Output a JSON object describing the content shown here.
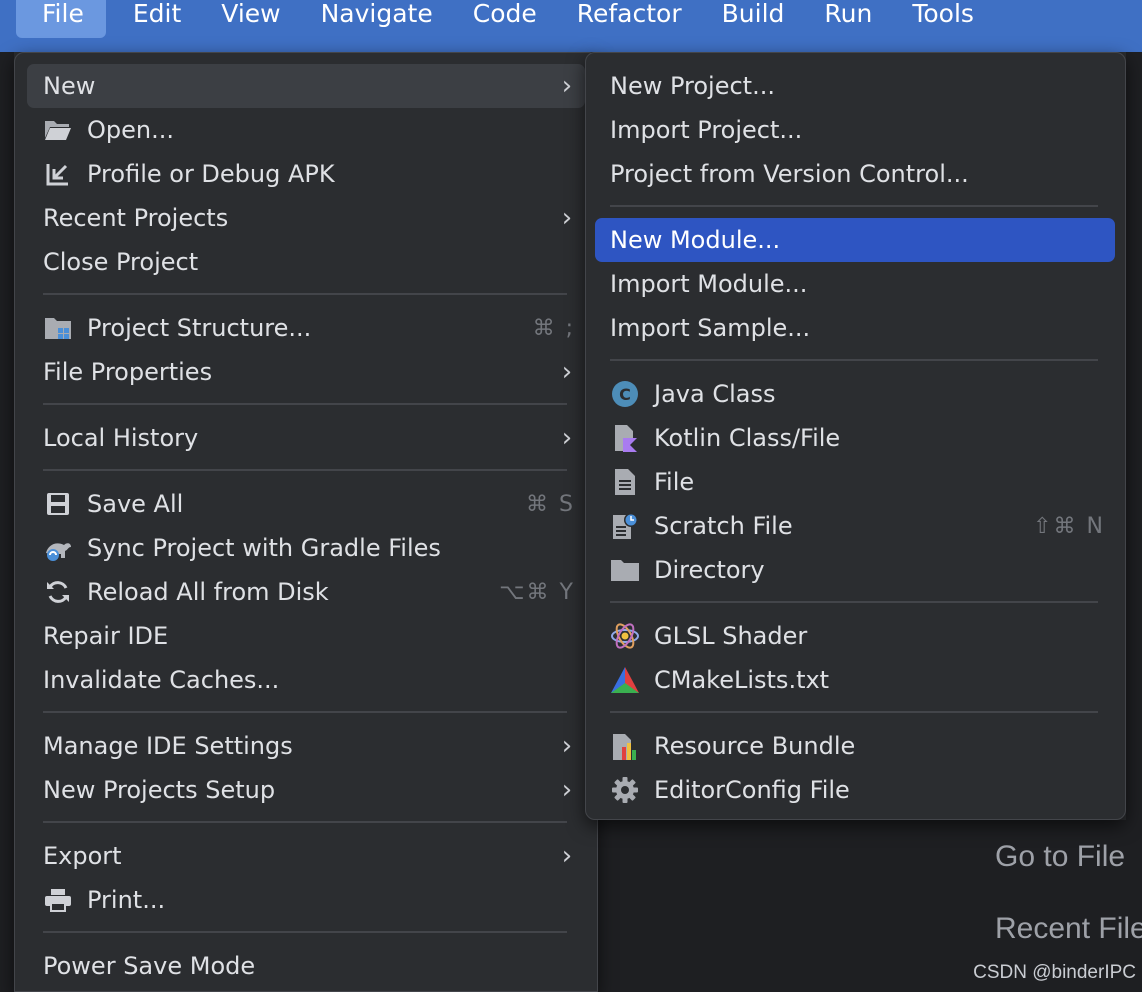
{
  "menubar": {
    "items": [
      "File",
      "Edit",
      "View",
      "Navigate",
      "Code",
      "Refactor",
      "Build",
      "Run",
      "Tools"
    ]
  },
  "file_menu": {
    "items": [
      {
        "label": "New",
        "has_submenu": true
      },
      {
        "label": "Open...",
        "icon": "folder-open-icon"
      },
      {
        "label": "Profile or Debug APK",
        "icon": "import-arrow-icon"
      },
      {
        "label": "Recent Projects",
        "has_submenu": true
      },
      {
        "label": "Close Project"
      },
      {
        "label": "Project Structure...",
        "icon": "project-structure-icon",
        "shortcut": "⌘ ;"
      },
      {
        "label": "File Properties",
        "has_submenu": true
      },
      {
        "label": "Local History",
        "has_submenu": true
      },
      {
        "label": "Save All",
        "icon": "save-icon",
        "shortcut": "⌘ S"
      },
      {
        "label": "Sync Project with Gradle Files",
        "icon": "gradle-sync-icon"
      },
      {
        "label": "Reload All from Disk",
        "icon": "reload-icon",
        "shortcut": "⌥⌘ Y"
      },
      {
        "label": "Repair IDE"
      },
      {
        "label": "Invalidate Caches..."
      },
      {
        "label": "Manage IDE Settings",
        "has_submenu": true
      },
      {
        "label": "New Projects Setup",
        "has_submenu": true
      },
      {
        "label": "Export",
        "has_submenu": true
      },
      {
        "label": "Print...",
        "icon": "printer-icon"
      },
      {
        "label": "Power Save Mode"
      }
    ]
  },
  "new_submenu": {
    "items": [
      {
        "label": "New Project..."
      },
      {
        "label": "Import Project..."
      },
      {
        "label": "Project from Version Control..."
      },
      {
        "label": "New Module...",
        "selected": true
      },
      {
        "label": "Import Module..."
      },
      {
        "label": "Import Sample..."
      },
      {
        "label": "Java Class",
        "icon": "java-class-icon"
      },
      {
        "label": "Kotlin Class/File",
        "icon": "kotlin-file-icon"
      },
      {
        "label": "File",
        "icon": "file-icon"
      },
      {
        "label": "Scratch File",
        "icon": "scratch-file-icon",
        "shortcut": "⇧⌘ N"
      },
      {
        "label": "Directory",
        "icon": "folder-icon"
      },
      {
        "label": "GLSL Shader",
        "icon": "glsl-shader-icon"
      },
      {
        "label": "CMakeLists.txt",
        "icon": "cmake-icon"
      },
      {
        "label": "Resource Bundle",
        "icon": "resource-bundle-icon"
      },
      {
        "label": "EditorConfig File",
        "icon": "gear-icon"
      }
    ]
  },
  "background": {
    "go_to_file": "Go to File",
    "recent_files": "Recent File",
    "watermark": "CSDN @binderIPC"
  },
  "colors": {
    "menubar": "#3f70c4",
    "selection": "#2e55c2",
    "menu_bg": "#2b2d30"
  }
}
